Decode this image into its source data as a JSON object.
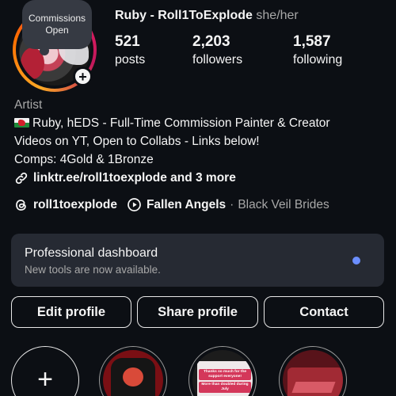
{
  "profile": {
    "note": "Commissions Open",
    "display_name": "Ruby - Roll1ToExplode",
    "pronouns": "she/her",
    "category": "Artist"
  },
  "stats": {
    "posts": {
      "value": "521",
      "label": "posts"
    },
    "followers": {
      "value": "2,203",
      "label": "followers"
    },
    "following": {
      "value": "1,587",
      "label": "following"
    }
  },
  "bio": {
    "line1": "Ruby, hEDS - Full-Time Commission Painter & Creator",
    "line2": "Videos on YT, Open to Collabs - Links below!",
    "line3": "Comps: 4Gold & 1Bronze",
    "link": "linktr.ee/roll1toexplode and 3 more"
  },
  "meta": {
    "threads_handle": "roll1toexplode",
    "music_title": "Fallen Angels",
    "separator": "·",
    "music_artist": "Black Veil Brides"
  },
  "dashboard": {
    "title": "Professional dashboard",
    "subtitle": "New tools are now available.",
    "dot_color": "#6b8eff"
  },
  "buttons": {
    "edit": "Edit profile",
    "share": "Share profile",
    "contact": "Contact"
  },
  "highlights": {
    "new_label": "+",
    "hl2_text1": "Thanks so much for the support everyone!",
    "hl2_text2": "More than doubled during July"
  },
  "icons": {
    "add_story": "plus-icon",
    "link": "link-icon",
    "threads": "threads-icon",
    "music": "play-circle-icon",
    "flag": "wales-flag-icon"
  },
  "colors": {
    "background": "#0c0f14",
    "card": "#262a33",
    "muted_text": "#a8a8a8",
    "ring_start": "#f9a825",
    "ring_end": "#e91e63"
  }
}
